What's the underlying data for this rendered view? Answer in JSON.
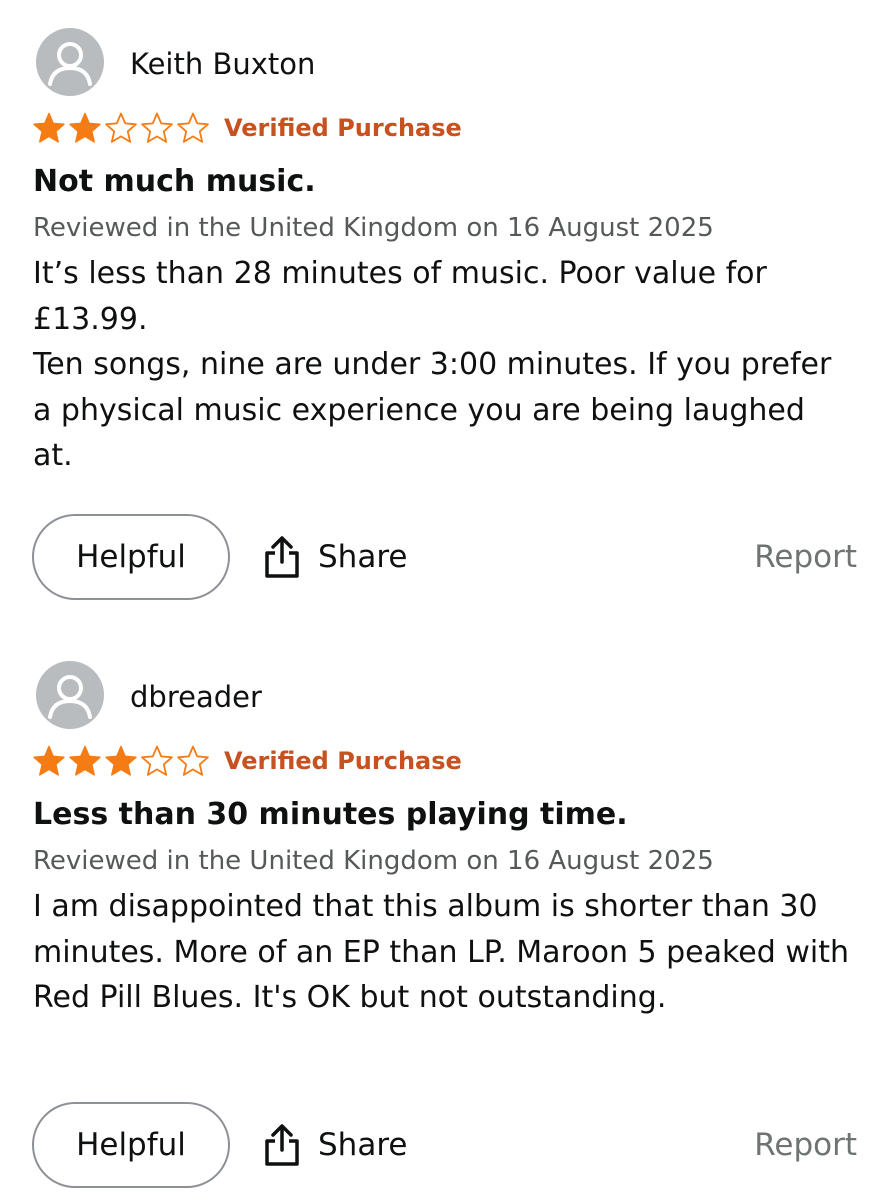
{
  "reviews": [
    {
      "reviewer": "Keith Buxton",
      "rating": 2,
      "max_rating": 5,
      "verified": "Verified Purchase",
      "title": "Not much music.",
      "date": "Reviewed in the United Kingdom on 16 August 2025",
      "body": [
        "It’s less than 28 minutes of music. Poor value for £13.99.",
        "Ten songs, nine are under 3:00 minutes. If you prefer a physical music experience you are being laughed at."
      ],
      "actions": {
        "helpful": "Helpful",
        "share": "Share",
        "report": "Report"
      }
    },
    {
      "reviewer": "dbreader",
      "rating": 3,
      "max_rating": 5,
      "verified": "Verified Purchase",
      "title": "Less than 30 minutes playing time.",
      "date": "Reviewed in the United Kingdom on 16 August 2025",
      "body": [
        "I am disappointed that this album is shorter than 30 minutes. More of an EP than LP. Maroon 5 peaked with Red Pill Blues. It's OK but not outstanding."
      ],
      "actions": {
        "helpful": "Helpful",
        "share": "Share",
        "report": "Report"
      }
    }
  ],
  "icons": {
    "avatar": "user-avatar-icon",
    "star_filled": "star-filled-icon",
    "star_empty": "star-empty-icon",
    "share": "share-icon"
  },
  "colors": {
    "star": "#f57c14",
    "verified": "#c7511f",
    "text": "#0f1111",
    "muted": "#565959",
    "report": "#6f7373",
    "avatar_bg": "#b8bcbf"
  }
}
